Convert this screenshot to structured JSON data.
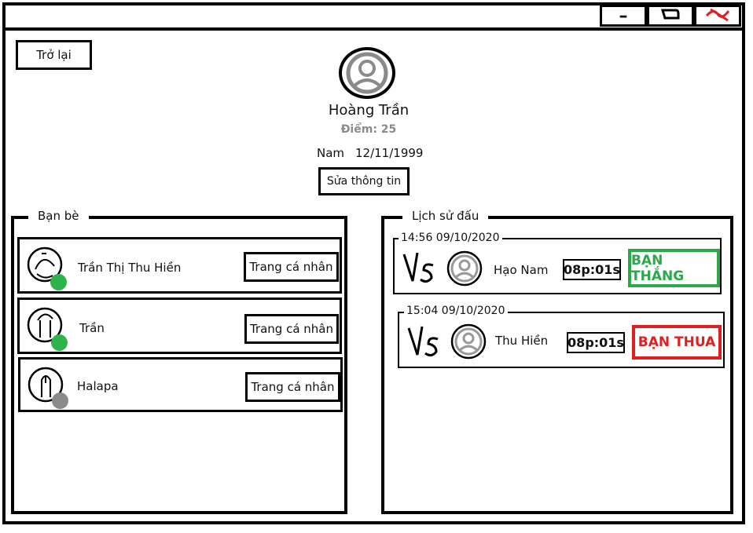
{
  "window": {
    "minimize_glyph": "–",
    "maximize_glyph": "ᗡ",
    "close_glyph": "✕",
    "close_color": "#e02020"
  },
  "profile": {
    "back_label": "Trở lại",
    "name": "Hoàng Trần",
    "score_label": "Điểm: 25",
    "gender": "Nam",
    "birthday": "12/11/1999",
    "edit_label": "Sửa thông tin"
  },
  "friends": {
    "title": "Bạn bè",
    "profile_button_label": "Trang cá nhân",
    "items": [
      {
        "name": "Trần Thị Thu Hiền",
        "status": "online",
        "status_color": "#2db34a"
      },
      {
        "name": "Trần",
        "status": "online",
        "status_color": "#2db34a"
      },
      {
        "name": "Halapa",
        "status": "offline",
        "status_color": "#8a8a8a"
      }
    ]
  },
  "history": {
    "title": "Lịch sử đấu",
    "matches": [
      {
        "datetime": "14:56 09/10/2020",
        "vs": "Vs",
        "opponent": "Hạo Nam",
        "time": "08p:01s",
        "result": "BẠN THẮNG",
        "result_color": "#2aa84a"
      },
      {
        "datetime": "15:04 09/10/2020",
        "vs": "Vs",
        "opponent": "Thu Hiền",
        "time": "08p:01s",
        "result": "BẠN THUA",
        "result_color": "#e02020"
      }
    ]
  }
}
